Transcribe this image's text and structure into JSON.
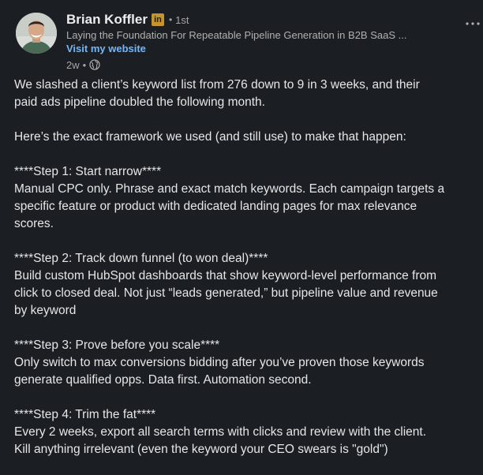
{
  "author": {
    "name": "Brian Koffler",
    "badge": "in",
    "connection_separator": "•",
    "connection": "1st",
    "headline": "Laying the Foundation For Repeatable Pipeline Generation in B2B SaaS ...",
    "website_link": "Visit my website",
    "time_ago": "2w",
    "time_separator": "•"
  },
  "colors": {
    "background": "#1b1f23",
    "link": "#71b7fb",
    "badge": "#c6942c"
  },
  "icons": {
    "visibility": "globe-icon",
    "menu": "more-options-icon"
  },
  "post": {
    "paragraphs": [
      {
        "lines": [
          "We slashed a client’s keyword list from 276 down to 9 in 3 weeks, and their",
          "paid ads pipeline doubled the following month."
        ]
      },
      {
        "lines": [
          "Here’s the exact framework we used (and still use) to make that happen:"
        ]
      },
      {
        "lines": [
          "****Step 1: Start narrow****",
          "Manual CPC only. Phrase and exact match keywords. Each campaign targets a",
          "specific feature or product with dedicated landing pages for max relevance",
          "scores."
        ]
      },
      {
        "lines": [
          "****Step 2: Track down funnel (to won deal)****",
          "Build custom HubSpot dashboards that show keyword-level performance from",
          "click to closed deal. Not just “leads generated,” but pipeline value and revenue",
          "by keyword"
        ]
      },
      {
        "lines": [
          "****Step 3: Prove before you scale****",
          "Only switch to max conversions bidding after you’ve proven those keywords",
          "generate qualified opps. Data first. Automation second."
        ]
      },
      {
        "lines": [
          "****Step 4: Trim the fat****",
          "Every 2 weeks, export all search terms with clicks and review with the client.",
          "Kill anything irrelevant (even the keyword your CEO swears is \"gold\")"
        ]
      }
    ]
  }
}
